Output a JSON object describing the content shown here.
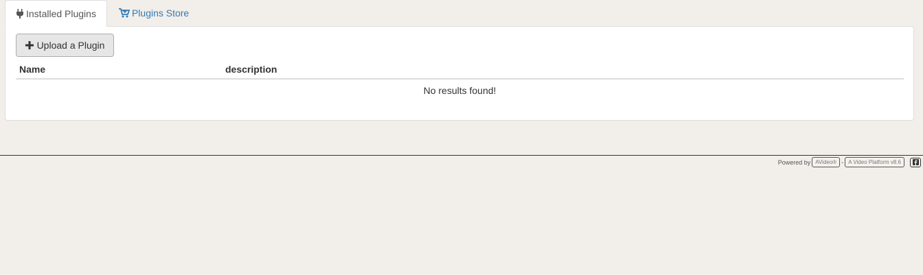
{
  "tabs": [
    {
      "label": "Installed Plugins",
      "icon": "plug-icon",
      "active": true
    },
    {
      "label": "Plugins Store",
      "icon": "cart-plus-icon",
      "active": false
    }
  ],
  "panel": {
    "upload_button_label": "Upload a Plugin",
    "table": {
      "columns": [
        "Name",
        "description"
      ],
      "empty_message": "No results found!"
    }
  },
  "footer": {
    "powered_by": "Powered by",
    "brand": "AVideo®",
    "separator": "-",
    "platform": "A Video Platform v8.6",
    "social_icon": "facebook-icon"
  },
  "colors": {
    "link": "#337ab7",
    "background": "#f2eeea"
  }
}
